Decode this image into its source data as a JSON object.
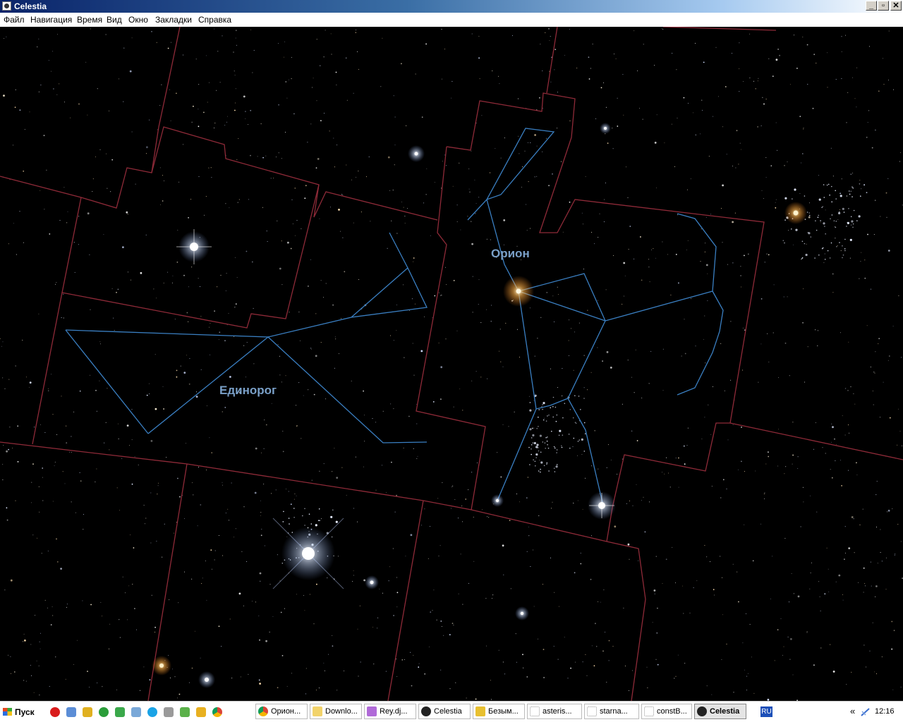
{
  "window": {
    "title": "Celestia",
    "controls": [
      "_",
      "▫",
      "✕"
    ]
  },
  "menu": [
    "Файл",
    "Навигация",
    "Время",
    "Вид",
    "Окно",
    "Закладки",
    "Справка"
  ],
  "constellations": [
    {
      "name": "Орион"
    },
    {
      "name": "Единорог"
    }
  ],
  "colors": {
    "boundary": "#8e2a38",
    "figure": "#3a7fc2",
    "label": "#7aa0c8",
    "title_gradient_start": "#0a246a",
    "sky": "#000000"
  },
  "taskbar": {
    "start": "Пуск",
    "quick_launch": [
      "opera-icon",
      "folder-icon",
      "tool-icon",
      "media-icon",
      "app-icon",
      "app-icon",
      "skype-icon",
      "pen-icon",
      "chrome-icon"
    ],
    "tasks": [
      {
        "label": "Орион...",
        "icon": "chrome-icon",
        "active": false
      },
      {
        "label": "Downlo...",
        "icon": "folder-icon",
        "active": false
      },
      {
        "label": "Rey.dj...",
        "icon": "image-icon",
        "active": false
      },
      {
        "label": "Celestia",
        "icon": "celestia-icon",
        "active": false
      },
      {
        "label": "Безым...",
        "icon": "paint-icon",
        "active": false
      },
      {
        "label": "asteris...",
        "icon": "document-icon",
        "active": false
      },
      {
        "label": "starna...",
        "icon": "document-icon",
        "active": false
      },
      {
        "label": "constB...",
        "icon": "document-icon",
        "active": false
      },
      {
        "label": "Celestia",
        "icon": "celestia-icon",
        "active": true
      }
    ],
    "language": "RU",
    "tray_arrow": "«",
    "clock": "12:16"
  }
}
